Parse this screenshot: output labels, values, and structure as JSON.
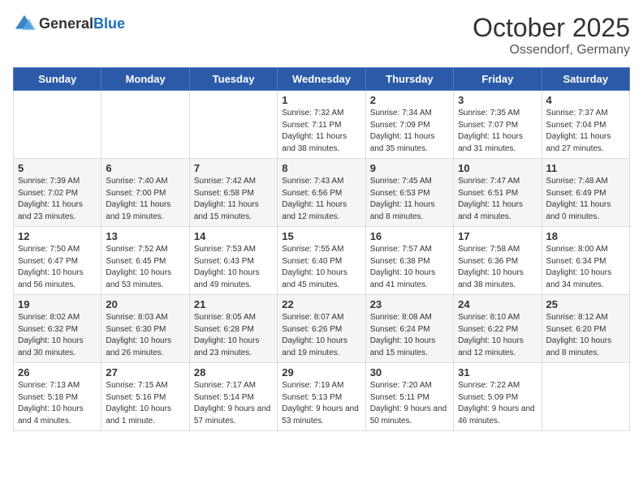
{
  "logo": {
    "general": "General",
    "blue": "Blue"
  },
  "title": "October 2025",
  "subtitle": "Ossendorf, Germany",
  "days_of_week": [
    "Sunday",
    "Monday",
    "Tuesday",
    "Wednesday",
    "Thursday",
    "Friday",
    "Saturday"
  ],
  "weeks": [
    [
      {
        "day": "",
        "info": ""
      },
      {
        "day": "",
        "info": ""
      },
      {
        "day": "",
        "info": ""
      },
      {
        "day": "1",
        "info": "Sunrise: 7:32 AM\nSunset: 7:11 PM\nDaylight: 11 hours and 38 minutes."
      },
      {
        "day": "2",
        "info": "Sunrise: 7:34 AM\nSunset: 7:09 PM\nDaylight: 11 hours and 35 minutes."
      },
      {
        "day": "3",
        "info": "Sunrise: 7:35 AM\nSunset: 7:07 PM\nDaylight: 11 hours and 31 minutes."
      },
      {
        "day": "4",
        "info": "Sunrise: 7:37 AM\nSunset: 7:04 PM\nDaylight: 11 hours and 27 minutes."
      }
    ],
    [
      {
        "day": "5",
        "info": "Sunrise: 7:39 AM\nSunset: 7:02 PM\nDaylight: 11 hours and 23 minutes."
      },
      {
        "day": "6",
        "info": "Sunrise: 7:40 AM\nSunset: 7:00 PM\nDaylight: 11 hours and 19 minutes."
      },
      {
        "day": "7",
        "info": "Sunrise: 7:42 AM\nSunset: 6:58 PM\nDaylight: 11 hours and 15 minutes."
      },
      {
        "day": "8",
        "info": "Sunrise: 7:43 AM\nSunset: 6:56 PM\nDaylight: 11 hours and 12 minutes."
      },
      {
        "day": "9",
        "info": "Sunrise: 7:45 AM\nSunset: 6:53 PM\nDaylight: 11 hours and 8 minutes."
      },
      {
        "day": "10",
        "info": "Sunrise: 7:47 AM\nSunset: 6:51 PM\nDaylight: 11 hours and 4 minutes."
      },
      {
        "day": "11",
        "info": "Sunrise: 7:48 AM\nSunset: 6:49 PM\nDaylight: 11 hours and 0 minutes."
      }
    ],
    [
      {
        "day": "12",
        "info": "Sunrise: 7:50 AM\nSunset: 6:47 PM\nDaylight: 10 hours and 56 minutes."
      },
      {
        "day": "13",
        "info": "Sunrise: 7:52 AM\nSunset: 6:45 PM\nDaylight: 10 hours and 53 minutes."
      },
      {
        "day": "14",
        "info": "Sunrise: 7:53 AM\nSunset: 6:43 PM\nDaylight: 10 hours and 49 minutes."
      },
      {
        "day": "15",
        "info": "Sunrise: 7:55 AM\nSunset: 6:40 PM\nDaylight: 10 hours and 45 minutes."
      },
      {
        "day": "16",
        "info": "Sunrise: 7:57 AM\nSunset: 6:38 PM\nDaylight: 10 hours and 41 minutes."
      },
      {
        "day": "17",
        "info": "Sunrise: 7:58 AM\nSunset: 6:36 PM\nDaylight: 10 hours and 38 minutes."
      },
      {
        "day": "18",
        "info": "Sunrise: 8:00 AM\nSunset: 6:34 PM\nDaylight: 10 hours and 34 minutes."
      }
    ],
    [
      {
        "day": "19",
        "info": "Sunrise: 8:02 AM\nSunset: 6:32 PM\nDaylight: 10 hours and 30 minutes."
      },
      {
        "day": "20",
        "info": "Sunrise: 8:03 AM\nSunset: 6:30 PM\nDaylight: 10 hours and 26 minutes."
      },
      {
        "day": "21",
        "info": "Sunrise: 8:05 AM\nSunset: 6:28 PM\nDaylight: 10 hours and 23 minutes."
      },
      {
        "day": "22",
        "info": "Sunrise: 8:07 AM\nSunset: 6:26 PM\nDaylight: 10 hours and 19 minutes."
      },
      {
        "day": "23",
        "info": "Sunrise: 8:08 AM\nSunset: 6:24 PM\nDaylight: 10 hours and 15 minutes."
      },
      {
        "day": "24",
        "info": "Sunrise: 8:10 AM\nSunset: 6:22 PM\nDaylight: 10 hours and 12 minutes."
      },
      {
        "day": "25",
        "info": "Sunrise: 8:12 AM\nSunset: 6:20 PM\nDaylight: 10 hours and 8 minutes."
      }
    ],
    [
      {
        "day": "26",
        "info": "Sunrise: 7:13 AM\nSunset: 5:18 PM\nDaylight: 10 hours and 4 minutes."
      },
      {
        "day": "27",
        "info": "Sunrise: 7:15 AM\nSunset: 5:16 PM\nDaylight: 10 hours and 1 minute."
      },
      {
        "day": "28",
        "info": "Sunrise: 7:17 AM\nSunset: 5:14 PM\nDaylight: 9 hours and 57 minutes."
      },
      {
        "day": "29",
        "info": "Sunrise: 7:19 AM\nSunset: 5:13 PM\nDaylight: 9 hours and 53 minutes."
      },
      {
        "day": "30",
        "info": "Sunrise: 7:20 AM\nSunset: 5:11 PM\nDaylight: 9 hours and 50 minutes."
      },
      {
        "day": "31",
        "info": "Sunrise: 7:22 AM\nSunset: 5:09 PM\nDaylight: 9 hours and 46 minutes."
      },
      {
        "day": "",
        "info": ""
      }
    ]
  ]
}
